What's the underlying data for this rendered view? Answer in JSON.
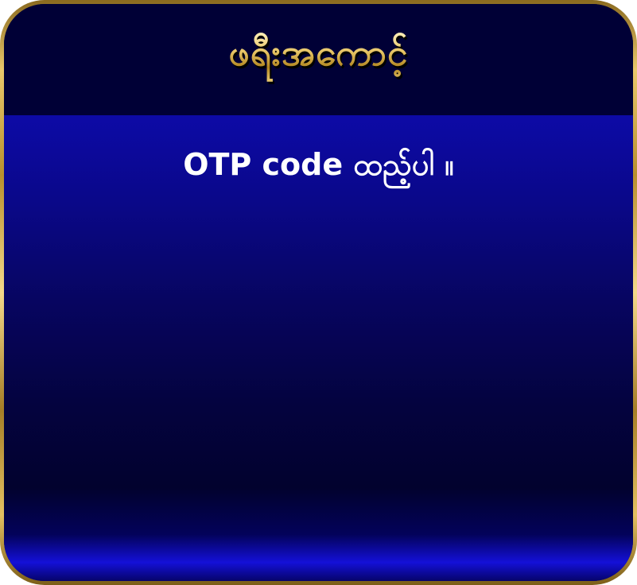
{
  "dialog": {
    "title": "ဖရီးအကောင့်",
    "message": "OTP code ထည့်ပါ ။"
  }
}
